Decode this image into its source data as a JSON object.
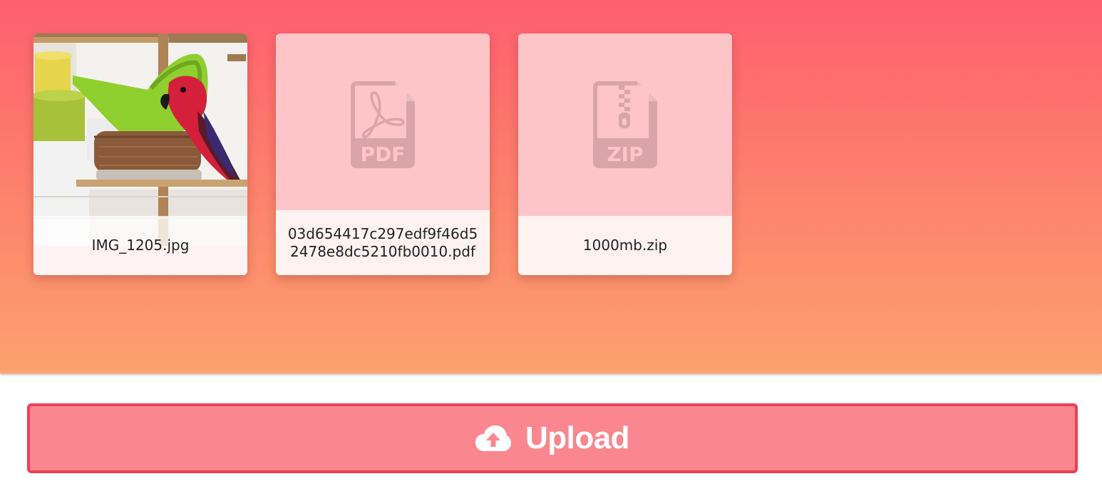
{
  "files": [
    {
      "name": "IMG_1205.jpg",
      "type": "image",
      "icon": "photo-thumbnail"
    },
    {
      "name": "03d654417c297edf9f46d52478e8dc5210fb0010.pdf",
      "type": "pdf",
      "icon": "pdf-file-icon",
      "badge": "PDF"
    },
    {
      "name": "1000mb.zip",
      "type": "zip",
      "icon": "zip-file-icon",
      "badge": "ZIP"
    }
  ],
  "upload": {
    "label": "Upload",
    "icon": "cloud-upload-icon"
  },
  "colors": {
    "gradient_top": "#fe5f70",
    "gradient_bottom": "#fca26e",
    "card_bg": "#fec5c8",
    "file_icon": "#d9a5a8",
    "button_bg": "#fa8790",
    "button_border": "#f03e56"
  }
}
